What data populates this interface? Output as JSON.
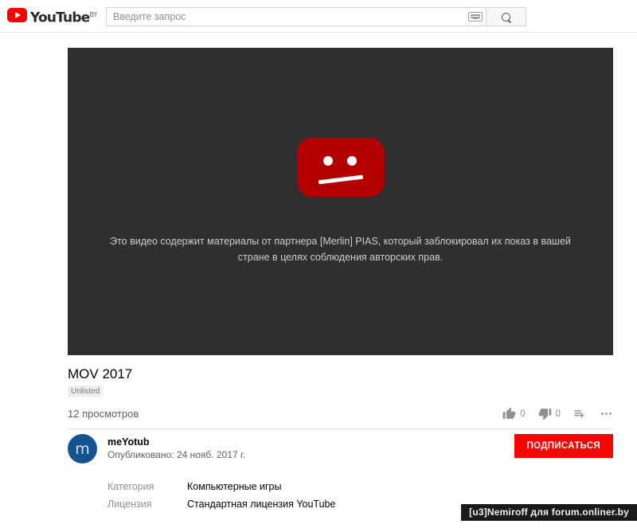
{
  "header": {
    "logo_text": "YouTube",
    "logo_country_code": "BY",
    "logo_icon": "youtube-play-icon",
    "search": {
      "placeholder": "Введите запрос",
      "value": "",
      "keyboard_icon": "keyboard-icon",
      "search_icon": "search-icon"
    }
  },
  "player": {
    "state_icon": "sad-face-blocked-icon",
    "message": "Это видео содержит материалы от партнера [Merlin] PIAS, который заблокировал их показ в вашей стране в целях соблюдения авторских прав.",
    "background_color": "#2f2f2f",
    "icon_color": "#b30000"
  },
  "video": {
    "title": "MOV 2017",
    "privacy_badge": "Unlisted",
    "views": "12 просмотров",
    "actions": {
      "like": {
        "icon": "thumb-up-icon",
        "count": "0"
      },
      "dislike": {
        "icon": "thumb-down-icon",
        "count": "0"
      },
      "add_to_playlist": {
        "icon": "add-to-playlist-icon"
      },
      "more": {
        "icon": "more-options-icon"
      }
    }
  },
  "channel": {
    "avatar_letter": "m",
    "avatar_color": "#14538f",
    "name": "meYotub",
    "published": "Опубликовано: 24 нояб. 2017 г.",
    "subscribe_label": "ПОДПИСАТЬСЯ",
    "subscribe_color": "#ff0000"
  },
  "details": [
    {
      "label": "Категория",
      "value": "Компьютерные игры"
    },
    {
      "label": "Лицензия",
      "value": "Стандартная лицензия YouTube"
    }
  ],
  "watermark": {
    "text": "[u3]Nemiroff для forum.onliner.by"
  }
}
